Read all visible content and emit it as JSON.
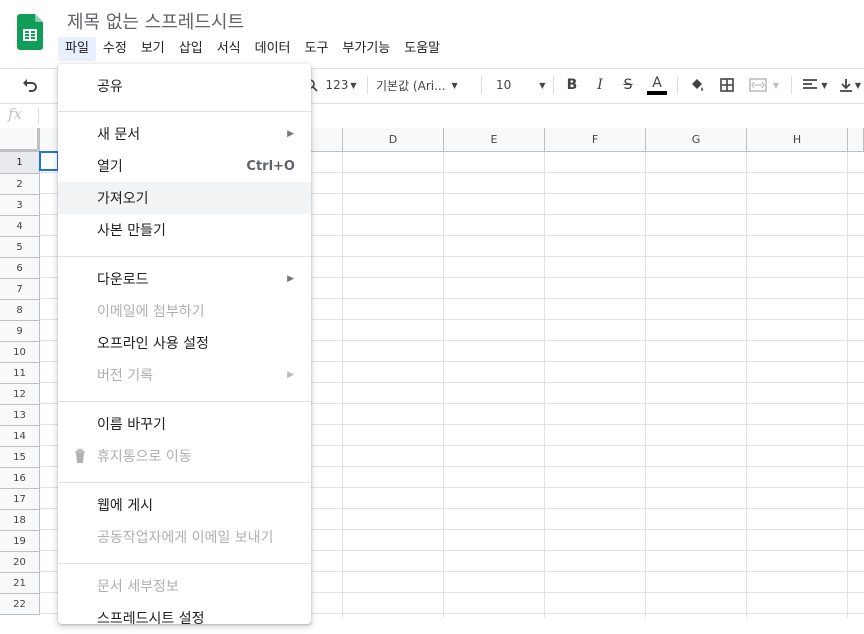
{
  "doc": {
    "title": "제목 없는 스프레드시트"
  },
  "menu": [
    "파일",
    "수정",
    "보기",
    "삽입",
    "서식",
    "데이터",
    "도구",
    "부가기능",
    "도움말"
  ],
  "toolbar": {
    "number_format": "123",
    "font_name": "기본값 (Ari...",
    "font_size": "10",
    "bold": "B",
    "italic": "I",
    "strike": "S",
    "text_color": "A"
  },
  "formula_bar": {
    "fx": "fx"
  },
  "columns": [
    "D",
    "E",
    "F",
    "G",
    "H"
  ],
  "rows": [
    "1",
    "2",
    "3",
    "4",
    "5",
    "6",
    "7",
    "8",
    "9",
    "10",
    "11",
    "12",
    "13",
    "14",
    "15",
    "16",
    "17",
    "18",
    "19",
    "20",
    "21",
    "22"
  ],
  "file_menu": {
    "share": "공유",
    "new": "새 문서",
    "open": "열기",
    "open_shortcut": "Ctrl+O",
    "import": "가져오기",
    "make_copy": "사본 만들기",
    "download": "다운로드",
    "email_attach": "이메일에 첨부하기",
    "offline": "오프라인 사용 설정",
    "version_history": "버전 기록",
    "rename": "이름 바꾸기",
    "trash": "휴지통으로 이동",
    "publish": "웹에 게시",
    "email_collab": "공동작업자에게 이메일 보내기",
    "details": "문서 세부정보",
    "settings": "스프레드시트 설정"
  },
  "colors": {
    "brand_green": "#0f9d58",
    "selection_blue": "#1a73e8",
    "menu_active": "#e8f0fe"
  }
}
